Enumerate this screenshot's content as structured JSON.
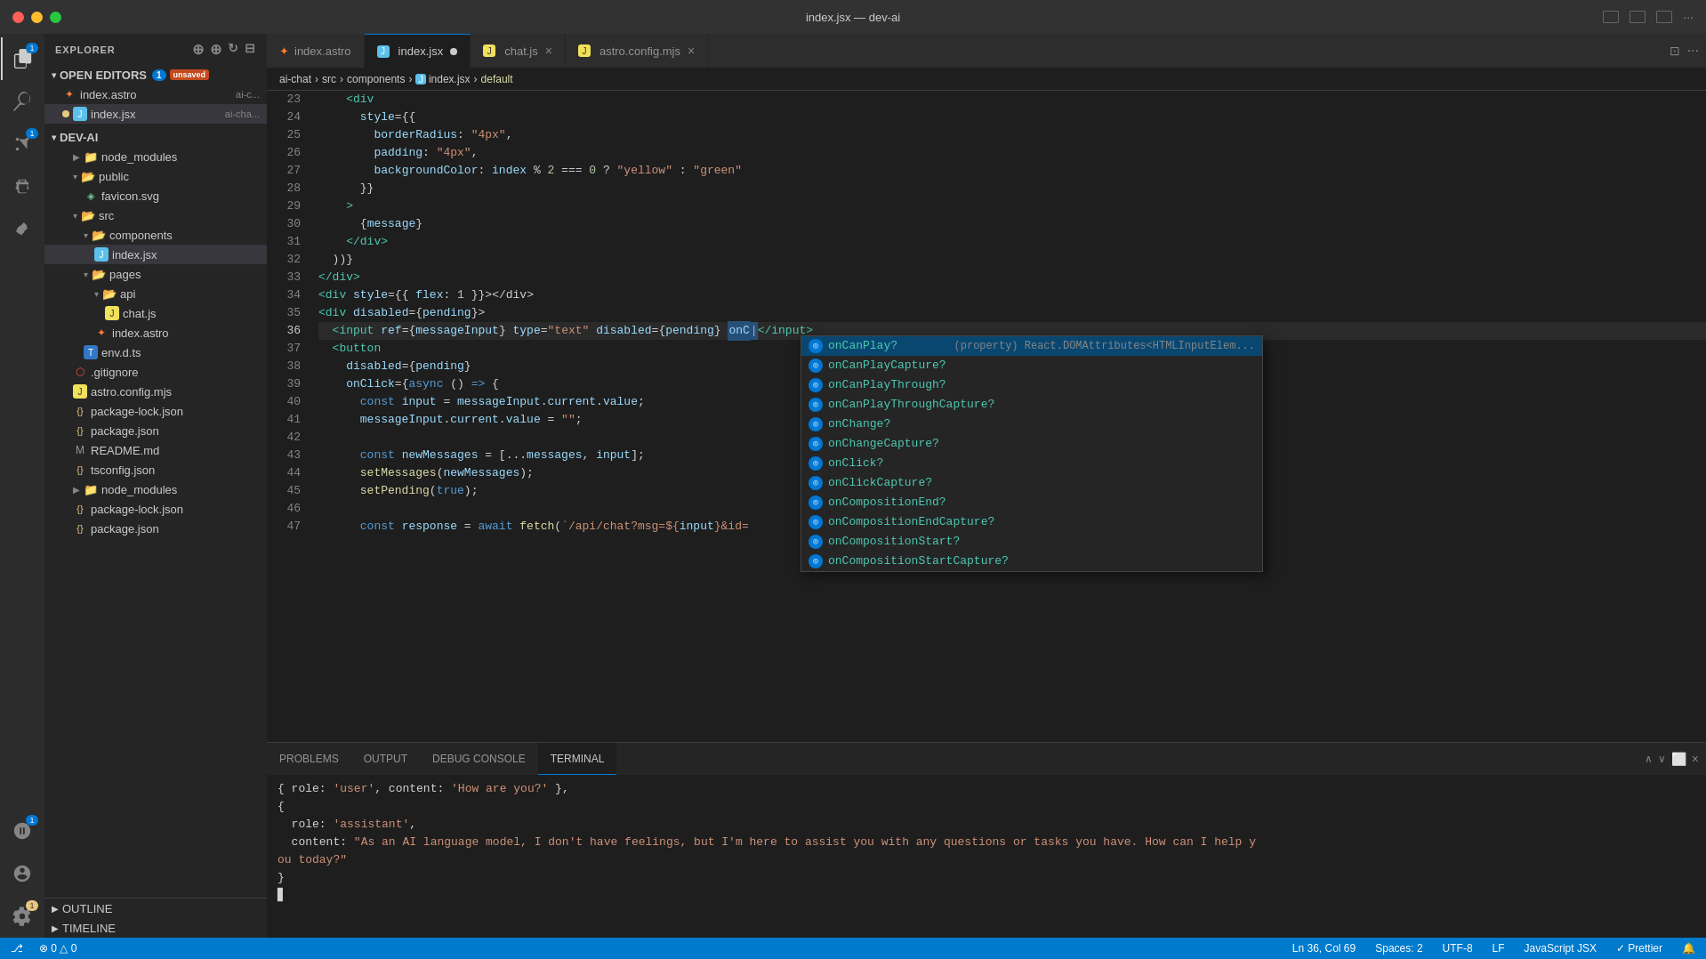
{
  "titlebar": {
    "title": "index.jsx — dev-ai"
  },
  "tabs": [
    {
      "id": "index-astro",
      "label": "index.astro",
      "icon": "astro",
      "active": false,
      "modified": false
    },
    {
      "id": "index-jsx",
      "label": "index.jsx",
      "icon": "jsx",
      "active": true,
      "modified": true
    },
    {
      "id": "chat-js",
      "label": "chat.js",
      "icon": "js",
      "active": false,
      "modified": false
    },
    {
      "id": "astro-config",
      "label": "astro.config.mjs",
      "icon": "js",
      "active": false,
      "modified": false
    }
  ],
  "breadcrumb": {
    "parts": [
      "ai-chat",
      "src",
      "components",
      "index.jsx",
      "default"
    ]
  },
  "sidebar": {
    "title": "EXPLORER",
    "sections": {
      "open_editors": "OPEN EDITORS",
      "dev_ai": "DEV-AI"
    },
    "open_editors": [
      {
        "name": "index.astro",
        "detail": "ai-c...",
        "icon": "astro",
        "modified": false
      },
      {
        "name": "index.jsx",
        "detail": "ai-cha...",
        "icon": "jsx",
        "modified": true
      }
    ],
    "tree": [
      {
        "name": "node_modules",
        "type": "folder",
        "indent": 1,
        "collapsed": true
      },
      {
        "name": "public",
        "type": "folder",
        "indent": 1,
        "collapsed": false
      },
      {
        "name": "favicon.svg",
        "type": "file",
        "icon": "svg",
        "indent": 2
      },
      {
        "name": "src",
        "type": "folder",
        "indent": 1,
        "collapsed": false
      },
      {
        "name": "components",
        "type": "folder",
        "indent": 2,
        "collapsed": false
      },
      {
        "name": "index.jsx",
        "type": "file",
        "icon": "jsx",
        "indent": 3,
        "selected": true
      },
      {
        "name": "pages",
        "type": "folder",
        "indent": 2,
        "collapsed": false
      },
      {
        "name": "api",
        "type": "folder",
        "indent": 3,
        "collapsed": false
      },
      {
        "name": "chat.js",
        "type": "file",
        "icon": "js",
        "indent": 4
      },
      {
        "name": "index.astro",
        "type": "file",
        "icon": "astro",
        "indent": 3
      },
      {
        "name": "env.d.ts",
        "type": "file",
        "icon": "ts",
        "indent": 2
      },
      {
        "name": ".gitignore",
        "type": "file",
        "icon": "git",
        "indent": 1
      },
      {
        "name": "astro.config.mjs",
        "type": "file",
        "icon": "js",
        "indent": 1
      },
      {
        "name": "package-lock.json",
        "type": "file",
        "icon": "json",
        "indent": 1
      },
      {
        "name": "package.json",
        "type": "file",
        "icon": "json",
        "indent": 1
      },
      {
        "name": "README.md",
        "type": "file",
        "icon": "md",
        "indent": 1
      },
      {
        "name": "tsconfig.json",
        "type": "file",
        "icon": "json",
        "indent": 1
      },
      {
        "name": "node_modules",
        "type": "folder",
        "indent": 1,
        "collapsed": true
      },
      {
        "name": "package-lock.json",
        "type": "file",
        "icon": "json",
        "indent": 1
      },
      {
        "name": "package.json",
        "type": "file",
        "icon": "json",
        "indent": 1
      }
    ]
  },
  "code": {
    "lines": [
      {
        "num": 23,
        "content": "    <div"
      },
      {
        "num": 24,
        "content": "      style={{"
      },
      {
        "num": 25,
        "content": "        borderRadius: \"4px\","
      },
      {
        "num": 26,
        "content": "        padding: \"4px\","
      },
      {
        "num": 27,
        "content": "        backgroundColor: index % 2 === 0 ? \"yellow\" : \"green\""
      },
      {
        "num": 28,
        "content": "      }}"
      },
      {
        "num": 29,
        "content": "    >"
      },
      {
        "num": 30,
        "content": "      {message}"
      },
      {
        "num": 31,
        "content": "    </div>"
      },
      {
        "num": 32,
        "content": "  ))}"
      },
      {
        "num": 33,
        "content": "</div>"
      },
      {
        "num": 34,
        "content": "<div style={{ flex: 1 }}></div>"
      },
      {
        "num": 35,
        "content": "<div disabled={pending}>"
      },
      {
        "num": 36,
        "content": "  <input ref={messageInput} type=\"text\" disabled={pending} onC|</input>"
      },
      {
        "num": 37,
        "content": "  <button"
      },
      {
        "num": 38,
        "content": "    disabled={pending}"
      },
      {
        "num": 39,
        "content": "    onClick={async () => {"
      },
      {
        "num": 40,
        "content": "      const input = messageInput.current.value;"
      },
      {
        "num": 41,
        "content": "      messageInput.current.value = \"\";"
      },
      {
        "num": 42,
        "content": ""
      },
      {
        "num": 43,
        "content": "      const newMessages = [...messages, input];"
      },
      {
        "num": 44,
        "content": "      setMessages(newMessages);"
      },
      {
        "num": 45,
        "content": "      setPending(true);"
      },
      {
        "num": 46,
        "content": ""
      },
      {
        "num": 47,
        "content": "      const response = await fetch(`/api/chat?msg=${input}&id="
      }
    ]
  },
  "autocomplete": {
    "items": [
      {
        "label": "onCanPlay?",
        "detail": "(property) React.DOMAttributes<HTMLInputElem...",
        "selected": true
      },
      {
        "label": "onCanPlayCapture?",
        "detail": ""
      },
      {
        "label": "onCanPlayThrough?",
        "detail": ""
      },
      {
        "label": "onCanPlayThroughCapture?",
        "detail": ""
      },
      {
        "label": "onChange?",
        "detail": ""
      },
      {
        "label": "onChangeCapture?",
        "detail": ""
      },
      {
        "label": "onClick?",
        "detail": ""
      },
      {
        "label": "onClickCapture?",
        "detail": ""
      },
      {
        "label": "onCompositionEnd?",
        "detail": ""
      },
      {
        "label": "onCompositionEndCapture?",
        "detail": ""
      },
      {
        "label": "onCompositionStart?",
        "detail": ""
      },
      {
        "label": "onCompositionStartCapture?",
        "detail": ""
      }
    ]
  },
  "terminal": {
    "tabs": [
      "PROBLEMS",
      "OUTPUT",
      "DEBUG CONSOLE",
      "TERMINAL"
    ],
    "active_tab": "TERMINAL",
    "content": [
      "{ role: 'user', content: 'How are you?' },",
      "{",
      "  role: 'assistant',",
      "  content: \"As an AI language model, I don't have feelings, but I'm here to assist you with any questions or tasks you have. How can I help y",
      "ou today?\"",
      "}"
    ],
    "cursor": "▊"
  },
  "statusbar": {
    "left": [
      "⎇",
      "0 △ 0 ⊗"
    ],
    "errors": "0",
    "warnings": "0",
    "ln": "Ln 36, Col 69",
    "spaces": "Spaces: 2",
    "encoding": "UTF-8",
    "eol": "LF",
    "language": "JavaScript JSX",
    "prettier": "Prettier",
    "bell": "🔔"
  }
}
